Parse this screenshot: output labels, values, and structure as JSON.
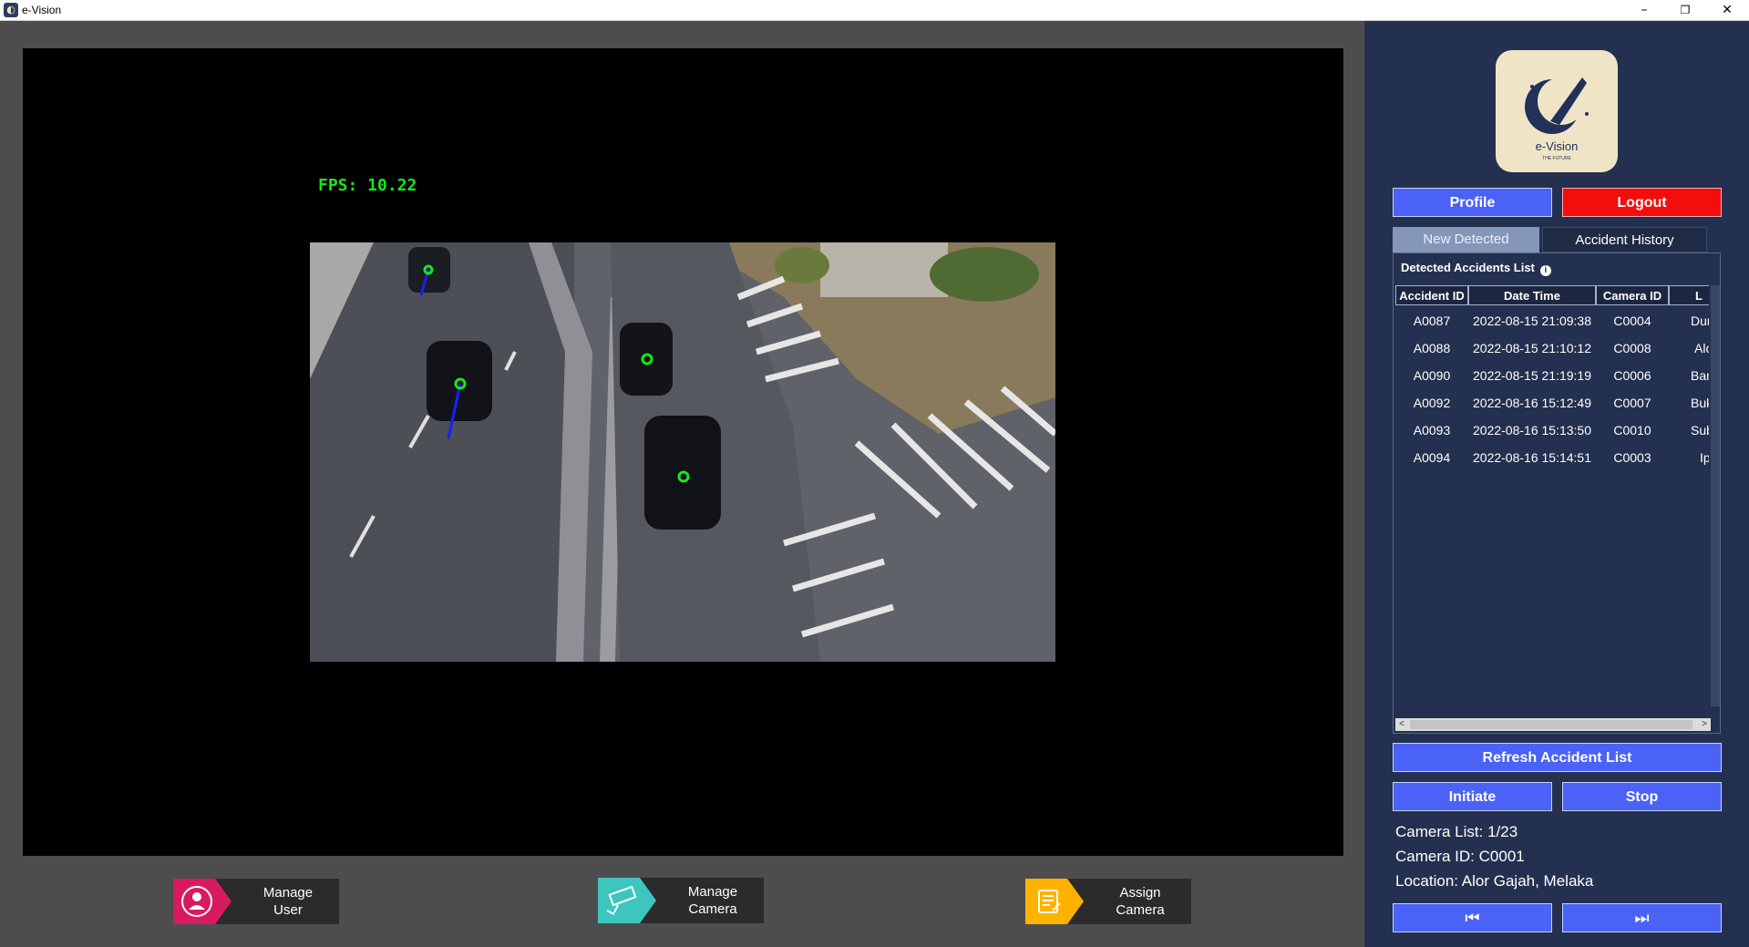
{
  "window": {
    "title": "e-Vision"
  },
  "video": {
    "fps_text": "FPS: 10.22"
  },
  "nav": {
    "manage_user": {
      "line1": "Manage",
      "line2": "User",
      "icon": "user-icon",
      "color": "#d81b60"
    },
    "manage_camera": {
      "line1": "Manage",
      "line2": "Camera",
      "icon": "cctv-camera-icon",
      "color": "#3cc6bd"
    },
    "assign_camera": {
      "line1": "Assign",
      "line2": "Camera",
      "icon": "checklist-icon",
      "color": "#ffb300"
    }
  },
  "sidebar": {
    "logo": {
      "name": "e-Vision",
      "tagline": "THE FUTURE"
    },
    "profile_label": "Profile",
    "logout_label": "Logout",
    "tabs": [
      {
        "label": "New Detected",
        "active": true
      },
      {
        "label": "Accident History",
        "active": false
      }
    ],
    "list_title": "Detected Accidents List",
    "columns": [
      "Accident ID",
      "Date Time",
      "Camera ID",
      "L"
    ],
    "rows": [
      {
        "id": "A0087",
        "datetime": "2022-08-15 21:09:38",
        "camera": "C0004",
        "location": "Dungu"
      },
      {
        "id": "A0088",
        "datetime": "2022-08-15 21:10:12",
        "camera": "C0008",
        "location": "Alor S"
      },
      {
        "id": "A0090",
        "datetime": "2022-08-15 21:19:19",
        "camera": "C0006",
        "location": "Bandar"
      },
      {
        "id": "A0092",
        "datetime": "2022-08-16 15:12:49",
        "camera": "C0007",
        "location": "Bukit M"
      },
      {
        "id": "A0093",
        "datetime": "2022-08-16 15:13:50",
        "camera": "C0010",
        "location": "Subang"
      },
      {
        "id": "A0094",
        "datetime": "2022-08-16 15:14:51",
        "camera": "C0003",
        "location": "Ipo"
      }
    ],
    "refresh_label": "Refresh Accident List",
    "initiate_label": "Initiate",
    "stop_label": "Stop",
    "camera_list": "Camera List: 1/23",
    "camera_id": "Camera ID: C0001",
    "location": "Location: Alor Gajah, Melaka",
    "prev_icon": "skip-previous-icon",
    "next_icon": "skip-next-icon"
  },
  "colors": {
    "sidebar_bg": "#24304f",
    "button_blue": "#4a62f5",
    "button_red": "#f30e0e",
    "fps_green": "#19e619"
  }
}
